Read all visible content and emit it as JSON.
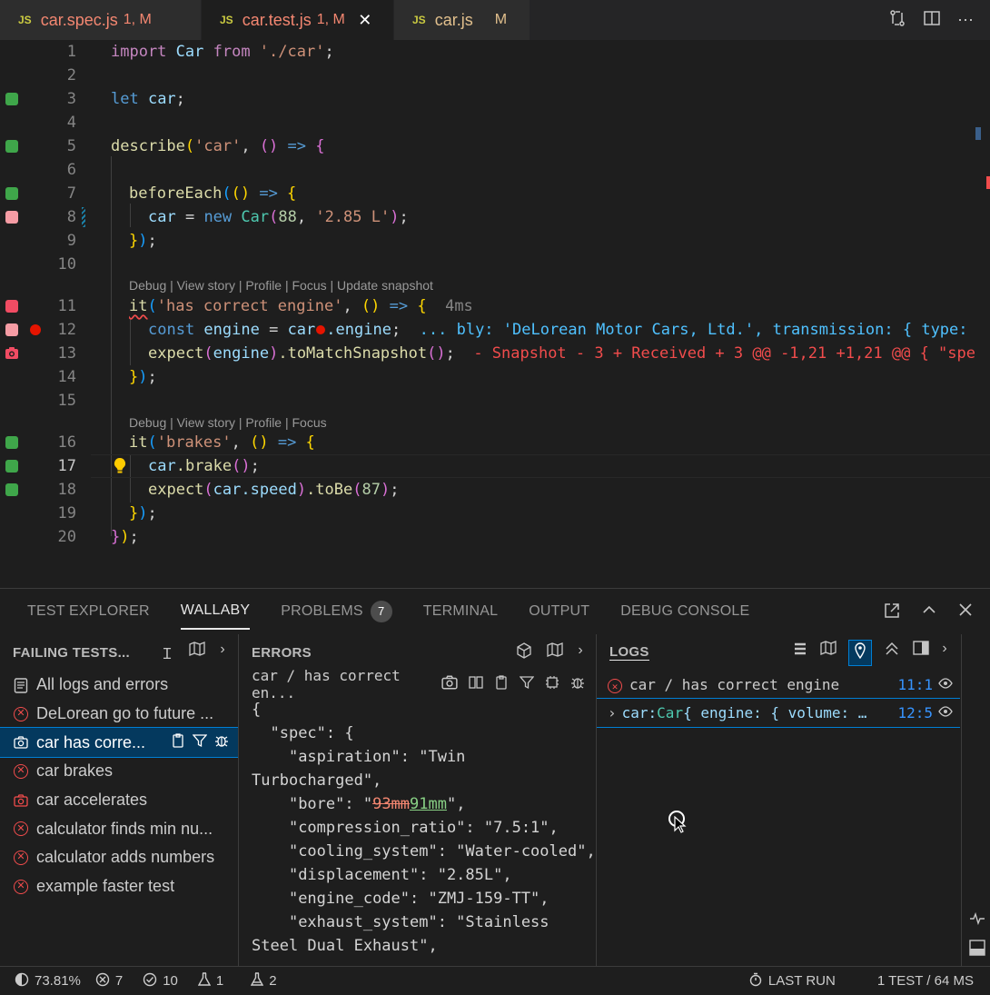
{
  "tabs": [
    {
      "name": "car.spec.js",
      "badge": "1, M",
      "active": false
    },
    {
      "name": "car.test.js",
      "badge": "1, M",
      "active": true
    },
    {
      "name": "car.js",
      "badge": "M",
      "active": false
    }
  ],
  "tab_icon_label": "JS",
  "editor": {
    "line_numbers": [
      "1",
      "2",
      "3",
      "4",
      "5",
      "6",
      "7",
      "8",
      "9",
      "10",
      "11",
      "12",
      "13",
      "14",
      "15",
      "16",
      "17",
      "18",
      "19",
      "20"
    ],
    "codelens_1": "Debug | View story | Profile | Focus | Update snapshot",
    "codelens_2": "Debug | View story | Profile | Focus",
    "l1": {
      "a": "import",
      "b": " Car ",
      "c": "from",
      "d": " './car'",
      "e": ";"
    },
    "l3": {
      "a": "let",
      "b": " car",
      "c": ";"
    },
    "l5": {
      "a": "describe",
      "b": "(",
      "c": "'car'",
      "d": ", ",
      "e": "()",
      "f": " => ",
      "g": "{"
    },
    "l7": {
      "a": "beforeEach",
      "b": "(",
      "c": "()",
      "d": " => ",
      "e": "{"
    },
    "l8": {
      "a": "car",
      "b": " = ",
      "c": "new",
      "d": " Car",
      "e": "(",
      "f": "88",
      "g": ", ",
      "h": "'2.85 L'",
      "i": ")",
      "j": ";"
    },
    "l9": {
      "a": "}",
      "b": ")",
      "c": ";"
    },
    "l11": {
      "a": "it",
      "b": "(",
      "c": "'has correct engine'",
      "d": ", ",
      "e": "()",
      "f": " => ",
      "g": "{",
      "h": "  4ms"
    },
    "l12": {
      "a": "const",
      "b": " engine",
      "c": " = ",
      "d": "car",
      "e": ".engine",
      "f": ";",
      "g": "  ... bly: 'DeLorean Motor Cars, Ltd.', transmission: { type: "
    },
    "l13": {
      "a": "expect",
      "b": "(",
      "c": "engine",
      "d": ")",
      "e": ".toMatchSnapshot",
      "f": "()",
      "g": ";",
      "h": "  - Snapshot - 3 + Received + 3 @@ -1,21 +1,21 @@ { \"spe"
    },
    "l14": {
      "a": "}",
      "b": ")",
      "c": ";"
    },
    "l16": {
      "a": "it",
      "b": "(",
      "c": "'brakes'",
      "d": ", ",
      "e": "()",
      "f": " => ",
      "g": "{"
    },
    "l17": {
      "a": "car",
      "b": ".brake",
      "c": "()",
      "d": ";"
    },
    "l18": {
      "a": "expect",
      "b": "(",
      "c": "car",
      "d": ".speed",
      "e": ")",
      "f": ".toBe",
      "g": "(",
      "h": "87",
      "i": ")",
      "j": ";"
    },
    "l19": {
      "a": "}",
      "b": ")",
      "c": ";"
    },
    "l20": {
      "a": "}",
      "b": ")",
      "c": ";"
    }
  },
  "panel": {
    "tabs": [
      "TEST EXPLORER",
      "WALLABY",
      "PROBLEMS",
      "TERMINAL",
      "OUTPUT",
      "DEBUG CONSOLE"
    ],
    "problems_count": "7",
    "failing": {
      "title": "FAILING TESTS...",
      "items": [
        "All logs and errors",
        "DeLorean go to future ...",
        "car has corre...",
        "car brakes",
        "car accelerates",
        "calculator finds min nu...",
        "calculator adds numbers",
        "example faster test"
      ]
    },
    "errors": {
      "title": "ERRORS",
      "test_name": "car / has correct en...",
      "json": {
        "l1": "{",
        "l2": "  \"spec\": {",
        "l3": "    \"aspiration\": \"Twin Turbocharged\",",
        "l4a": "    \"bore\": \"",
        "l4_del": "93mm",
        "l4_ins": "91mm",
        "l4b": "\",",
        "l5": "    \"compression_ratio\": \"7.5:1\",",
        "l6": "    \"cooling_system\": \"Water-cooled\",",
        "l7": "    \"displacement\": \"2.85L\",",
        "l8": "    \"engine_code\": \"ZMJ-159-TT\",",
        "l9": "    \"exhaust_system\": \"Stainless Steel Dual Exhaust\","
      }
    },
    "logs": {
      "title": "LOGS",
      "row1": {
        "text": "car / has correct engine",
        "pos": "11:1"
      },
      "row2": {
        "key": "car:",
        "type": " Car",
        "rest": " { engine: { volume: …",
        "pos": "12:5"
      }
    }
  },
  "status": {
    "coverage": "73.81%",
    "errors": "7",
    "passed": "10",
    "flask1": "1",
    "flask2": "2",
    "last_run": "LAST RUN",
    "summary": "1 TEST / 64 MS"
  },
  "colors": {
    "accent": "#007fd4",
    "error": "#f14c4c",
    "pass": "#3fa64a"
  }
}
